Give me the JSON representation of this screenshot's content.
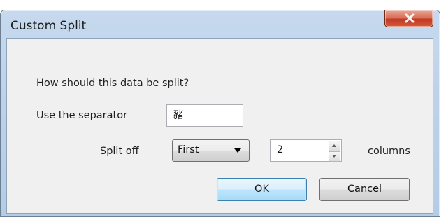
{
  "window": {
    "title": "Custom Split"
  },
  "form": {
    "question": "How should this data be split?",
    "separator_label": "Use the separator",
    "separator_value": "豬",
    "split_off_label": "Split off",
    "split_off_selected": "First",
    "columns_count": "2",
    "columns_label": "columns"
  },
  "buttons": {
    "ok_label": "OK",
    "cancel_label": "Cancel"
  },
  "icons": {
    "close": "close-icon",
    "dropdown": "chevron-down-icon",
    "spin_up": "arrow-up-icon",
    "spin_down": "arrow-down-icon"
  },
  "colors": {
    "close_button": "#c9452a",
    "frame": "#bcd2ea",
    "client_bg": "#f0f0f0",
    "default_button_border": "#3c7fb1"
  }
}
